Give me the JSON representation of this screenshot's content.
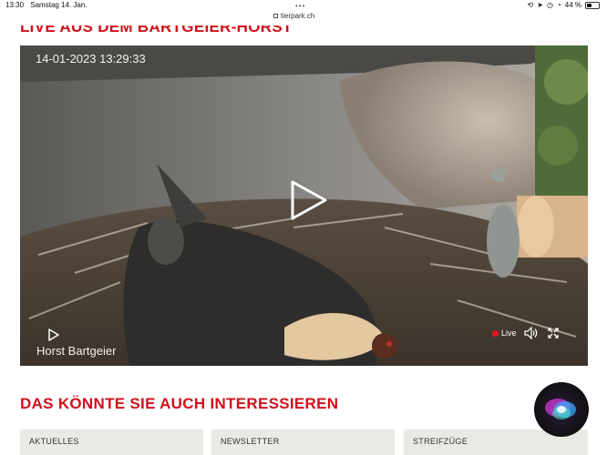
{
  "status_bar": {
    "time": "13:30",
    "date": "Samstag 14. Jan.",
    "url": "tierpark.ch",
    "battery": "44 %",
    "battery_level": 0.44
  },
  "live_section": {
    "title": "LIVE AUS DEM BARTGEIER-HORST"
  },
  "video": {
    "timestamp": "14-01-2023 13:29:33",
    "camera_name": "Horst Bartgeier",
    "live_label": "Live",
    "colors": {
      "live_dot": "#e3171e",
      "overlay_text": "#f2f2f2"
    }
  },
  "interest_section": {
    "title": "DAS KÖNNTE SIE AUCH INTERESSIEREN",
    "cards": [
      {
        "label": "AKTUELLES"
      },
      {
        "label": "NEWSLETTER"
      },
      {
        "label": "STREIFZÜGE"
      }
    ]
  },
  "theme": {
    "accent": "#d0101a",
    "card_bg": "#ebe9e4"
  }
}
